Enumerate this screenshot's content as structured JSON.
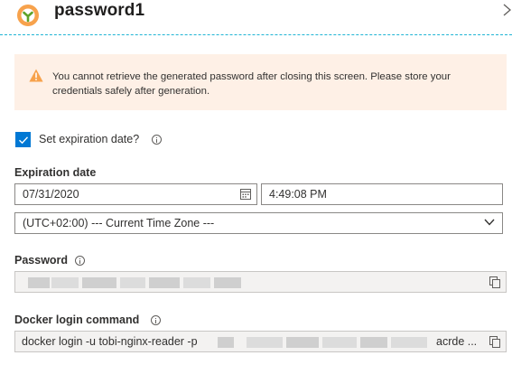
{
  "header": {
    "title": "password1"
  },
  "warning": {
    "text": "You cannot retrieve the generated password after closing this screen. Please store your credentials safely after generation."
  },
  "expiration_toggle": {
    "label": "Set expiration date?",
    "checked": true
  },
  "expiration": {
    "label": "Expiration date",
    "date": "07/31/2020",
    "time": "4:49:08 PM",
    "timezone": "(UTC+02:00) --- Current Time Zone ---"
  },
  "password": {
    "label": "Password"
  },
  "docker_login": {
    "label": "Docker login command",
    "command_start": "docker login -u tobi-nginx-reader -p",
    "command_end": "acrde ..."
  },
  "colors": {
    "accent": "#0078d4",
    "warning_bg": "#fef0e6",
    "warning_icon": "#f7a24c",
    "divider": "#20b4d4"
  }
}
